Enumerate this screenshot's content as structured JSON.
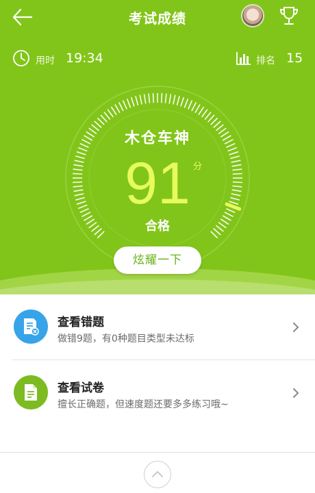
{
  "header": {
    "title": "考试成绩",
    "back_icon": "back-arrow-icon",
    "trophy_icon": "trophy-icon"
  },
  "stats": {
    "time_label": "用时",
    "time_value": "19:34",
    "rank_label": "排名",
    "rank_value": "15"
  },
  "result": {
    "nickname": "木仓车神",
    "score": "91",
    "score_unit": "分",
    "verdict": "合格",
    "share_label": "炫耀一下"
  },
  "actions": [
    {
      "title": "查看错题",
      "subtitle": "做错9题，有0种题目类型未达标",
      "icon": "wrong-questions-icon",
      "color": "#37a4ea"
    },
    {
      "title": "查看试卷",
      "subtitle": "擅长正确题，但速度题还要多多练习哦~",
      "icon": "exam-paper-icon",
      "color": "#7cbb22"
    }
  ],
  "footer": {
    "up_icon": "chevron-up-icon"
  },
  "colors": {
    "brand_green": "#82c51a",
    "score_yellow": "#e8fb5c",
    "text_dark": "#222222"
  }
}
